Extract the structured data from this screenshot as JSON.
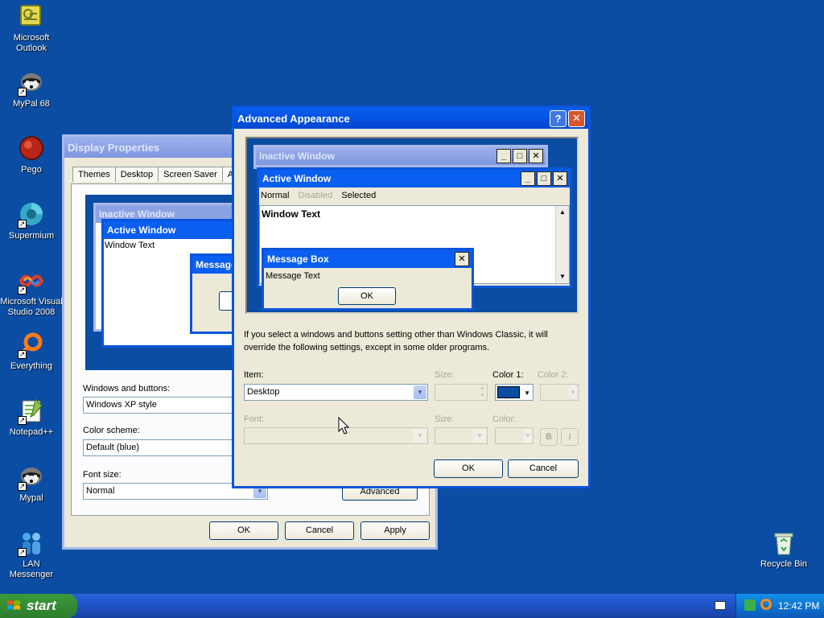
{
  "desktop": {
    "icons": [
      {
        "label": "Microsoft Outlook",
        "icon": "outlook-icon"
      },
      {
        "label": "MyPal 68",
        "icon": "raccoon-icon"
      },
      {
        "label": "Pego",
        "icon": "pego-icon"
      },
      {
        "label": "Supermium",
        "icon": "supermium-icon"
      },
      {
        "label": "Microsoft Visual Studio 2008",
        "icon": "visual-studio-icon"
      },
      {
        "label": "Everything",
        "icon": "everything-icon"
      },
      {
        "label": "Notepad++",
        "icon": "notepadpp-icon"
      },
      {
        "label": "Mypal",
        "icon": "raccoon-icon"
      },
      {
        "label": "LAN Messenger",
        "icon": "lan-messenger-icon"
      },
      {
        "label": "Recycle Bin",
        "icon": "recycle-bin-icon"
      }
    ]
  },
  "display_properties": {
    "title": "Display Properties",
    "tabs": [
      "Themes",
      "Desktop",
      "Screen Saver",
      "A"
    ],
    "preview": {
      "inactive_title": "Inactive Window",
      "active_title": "Active Window",
      "window_text": "Window Text",
      "message_title": "Message"
    },
    "windows_buttons_label": "Windows and buttons:",
    "windows_buttons_value": "Windows XP style",
    "color_scheme_label": "Color scheme:",
    "color_scheme_value": "Default (blue)",
    "font_size_label": "Font size:",
    "font_size_value": "Normal",
    "advanced_label": "Advanced",
    "ok_label": "OK",
    "cancel_label": "Cancel",
    "apply_label": "Apply"
  },
  "advanced_appearance": {
    "title": "Advanced Appearance",
    "help_glyph": "?",
    "close_glyph": "✕",
    "preview": {
      "inactive_title": "Inactive Window",
      "active_title": "Active Window",
      "menu_normal": "Normal",
      "menu_disabled": "Disabled",
      "menu_selected": "Selected",
      "window_text": "Window Text",
      "message_title": "Message Box",
      "message_text": "Message Text",
      "ok_label": "OK"
    },
    "info_text": "If you select a windows and buttons setting other than Windows Classic, it will override the following settings, except in some older programs.",
    "item_label": "Item:",
    "item_value": "Desktop",
    "size_label": "Size:",
    "color1_label": "Color 1:",
    "color2_label": "Color 2:",
    "font_label": "Font:",
    "font_size_label": "Size:",
    "font_color_label": "Color:",
    "bold_glyph": "B",
    "italic_glyph": "I",
    "color1_value": "#0a4da3",
    "ok_label": "OK",
    "cancel_label": "Cancel"
  },
  "taskbar": {
    "start_label": "start",
    "clock": "12:42 PM"
  },
  "colors": {
    "desktop": "#0a4da3",
    "titlebar_active": "#0a5ef0",
    "titlebar_inactive": "#7d96e0",
    "dialog_face": "#ece9d8"
  }
}
